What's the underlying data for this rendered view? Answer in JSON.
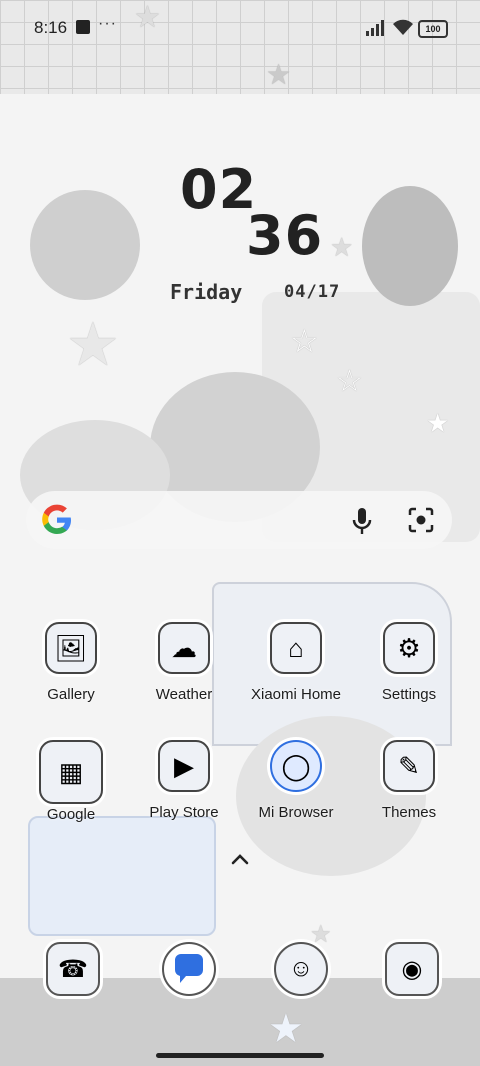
{
  "status": {
    "time": "8:16",
    "dots": "···",
    "battery": "100"
  },
  "clock": {
    "hours": "02",
    "minutes": "36",
    "day": "Friday",
    "date": "04/17"
  },
  "search": {
    "google_icon": "google-g-icon",
    "mic_icon": "mic-icon",
    "lens_icon": "lens-icon"
  },
  "apps_row1": [
    {
      "label": "Gallery",
      "icon": "gallery-icon"
    },
    {
      "label": "Weather",
      "icon": "weather-icon"
    },
    {
      "label": "Xiaomi Home",
      "icon": "xiaomi-home-icon"
    },
    {
      "label": "Settings",
      "icon": "settings-icon"
    }
  ],
  "apps_row2": [
    {
      "label": "Google",
      "icon": "google-folder-icon"
    },
    {
      "label": "Play Store",
      "icon": "play-store-icon"
    },
    {
      "label": "Mi Browser",
      "icon": "mi-browser-icon"
    },
    {
      "label": "Themes",
      "icon": "themes-icon"
    }
  ],
  "dock": [
    {
      "icon": "phone-icon"
    },
    {
      "icon": "messages-icon"
    },
    {
      "icon": "contacts-icon"
    },
    {
      "icon": "camera-icon"
    }
  ],
  "colors": {
    "accent_blue": "#2f6fe0",
    "text": "#1d1d1d"
  }
}
